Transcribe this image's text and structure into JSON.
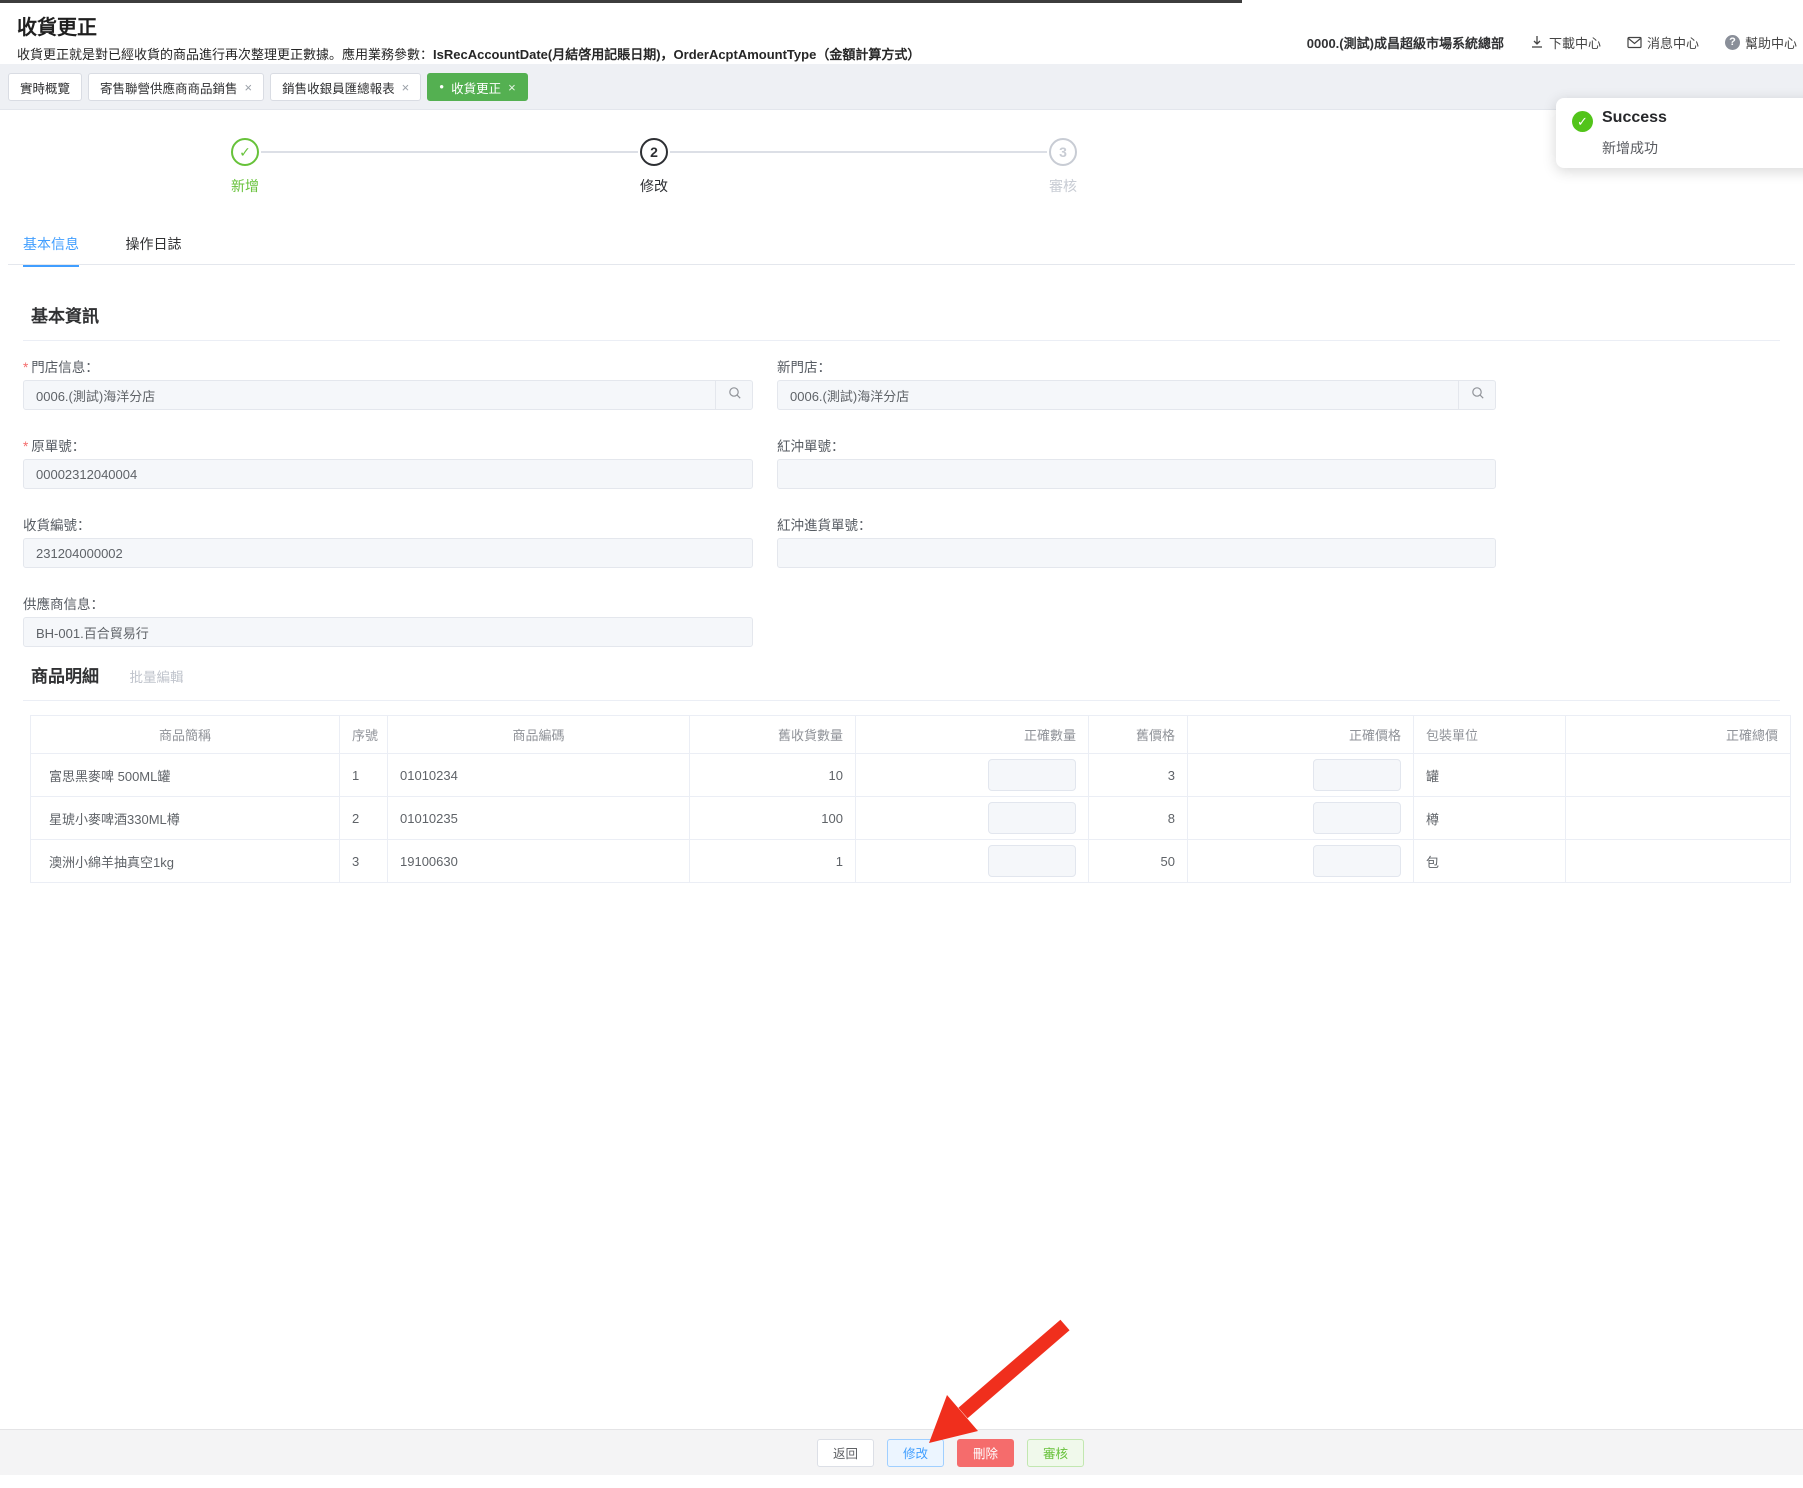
{
  "header": {
    "title": "收貨更正",
    "desc_prefix": "收貨更正就是對已經收貨的商品進行再次整理更正數據。應用業務參數：",
    "desc_param_bold": "IsRecAccountDate(月結啓用記賬日期)，OrderAcptAmountType",
    "desc_tail": "（金額計算方式）",
    "org": "0000.(測試)成昌超級市場系統總部",
    "links": {
      "download": "下載中心",
      "message": "消息中心",
      "help": "幫助中心"
    }
  },
  "tabs": {
    "close_glyph": "×",
    "active_dot": "●",
    "items": [
      {
        "label": "實時概覽",
        "closable": false,
        "active": false
      },
      {
        "label": "寄售聯營供應商商品銷售",
        "closable": true,
        "active": false
      },
      {
        "label": "銷售收銀員匯總報表",
        "closable": true,
        "active": false
      },
      {
        "label": "收貨更正",
        "closable": true,
        "active": true
      }
    ]
  },
  "toast": {
    "title": "Success",
    "message": "新增成功",
    "check_glyph": "✓"
  },
  "steps": [
    {
      "label": "新增",
      "glyph": "✓",
      "status": "done"
    },
    {
      "label": "修改",
      "glyph": "2",
      "status": "current"
    },
    {
      "label": "審核",
      "glyph": "3",
      "status": "wait"
    }
  ],
  "detail_tabs": [
    {
      "label": "基本信息",
      "active": true
    },
    {
      "label": "操作日誌",
      "active": false
    }
  ],
  "sections": {
    "basic": "基本資訊",
    "items": "商品明細",
    "batch_edit": "批量編輯"
  },
  "form": {
    "required_mark": "*",
    "fields": [
      {
        "label": "門店信息：",
        "required": true,
        "value": "0006.(測試)海洋分店",
        "search": true
      },
      {
        "label": "原單號：",
        "required": true,
        "value": "00002312040004"
      },
      {
        "label": "收貨編號：",
        "required": false,
        "value": "231204000002"
      },
      {
        "label": "供應商信息：",
        "required": false,
        "value": "BH-001.百合貿易行"
      },
      {
        "label": "新門店：",
        "required": false,
        "value": "0006.(測試)海洋分店",
        "search": true
      },
      {
        "label": "紅沖單號：",
        "required": false,
        "value": ""
      },
      {
        "label": "紅沖進貨單號：",
        "required": false,
        "value": ""
      }
    ]
  },
  "table": {
    "columns": [
      "商品簡稱",
      "序號",
      "商品編碼",
      "舊收貨數量",
      "正確數量",
      "舊價格",
      "正確價格",
      "包裝單位",
      "正確總價"
    ],
    "rows": [
      {
        "name": "富思黑麥啤 500ML罐",
        "seq": "1",
        "code": "01010234",
        "old_qty": "10",
        "new_qty": "",
        "old_price": "3",
        "new_price": "",
        "unit": "罐",
        "total": ""
      },
      {
        "name": "星琥小麥啤酒330ML樽",
        "seq": "2",
        "code": "01010235",
        "old_qty": "100",
        "new_qty": "",
        "old_price": "8",
        "new_price": "",
        "unit": "樽",
        "total": ""
      },
      {
        "name": "澳洲小綿羊抽真空1kg",
        "seq": "3",
        "code": "19100630",
        "old_qty": "1",
        "new_qty": "",
        "old_price": "50",
        "new_price": "",
        "unit": "包",
        "total": ""
      }
    ]
  },
  "footer": {
    "back": "返回",
    "edit": "修改",
    "delete": "刪除",
    "audit": "審核"
  },
  "colors": {
    "primary_blue": "#409eff",
    "step_green": "#67c23a",
    "tab_active_green": "#54b051",
    "toast_green": "#52c41a",
    "danger_red": "#f56c6c",
    "arrow_red": "#f02f1d"
  }
}
